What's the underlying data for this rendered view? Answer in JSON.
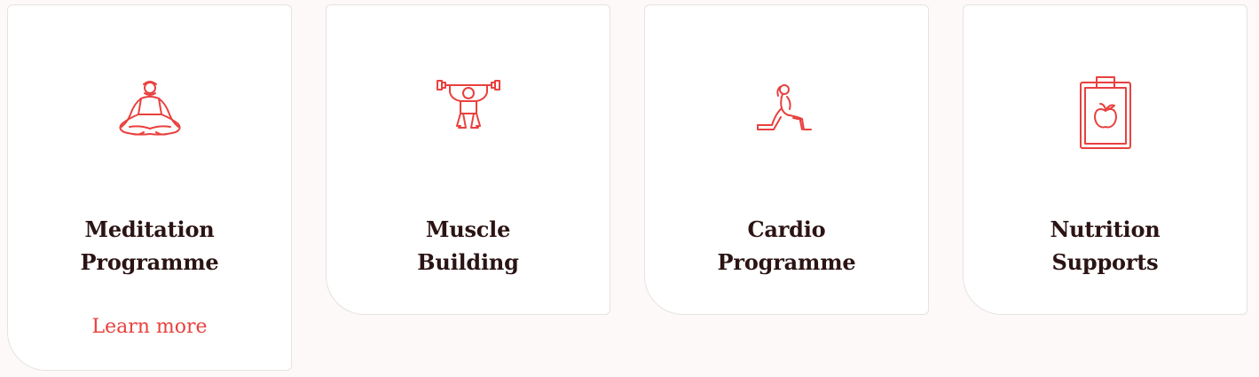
{
  "accent_color": "#e8413e",
  "title_color": "#2c1414",
  "cards": [
    {
      "icon": "meditation-icon",
      "title_line1": "Meditation",
      "title_line2": "Programme",
      "link_label": "Learn more"
    },
    {
      "icon": "weightlifting-icon",
      "title_line1": "Muscle",
      "title_line2": "Building"
    },
    {
      "icon": "lunge-stretch-icon",
      "title_line1": "Cardio",
      "title_line2": "Programme"
    },
    {
      "icon": "nutrition-clipboard-icon",
      "title_line1": "Nutrition",
      "title_line2": "Supports"
    }
  ]
}
